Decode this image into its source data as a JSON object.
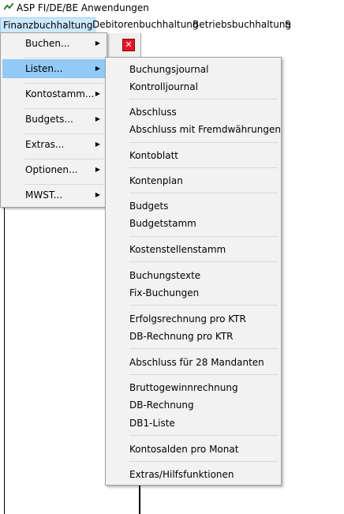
{
  "window": {
    "title": "ASP FI/DE/BE Anwendungen",
    "icon": "app-icon"
  },
  "menubar": {
    "items": [
      "Finanzbuchhaltung",
      "Debitorenbuchhaltung",
      "Betriebsbuchhaltung",
      "S"
    ]
  },
  "menu1": {
    "items": [
      "Buchen...",
      "Listen...",
      "Kontostamm...",
      "Budgets...",
      "Extras...",
      "Optionen...",
      "MWST..."
    ],
    "highlighted": "Listen..."
  },
  "menu2": {
    "groups": [
      [
        "Buchungsjournal",
        "Kontrolljournal"
      ],
      [
        "Abschluss",
        "Abschluss mit Fremdwährungen"
      ],
      [
        "Kontoblatt"
      ],
      [
        "Kontenplan"
      ],
      [
        "Budgets",
        "Budgetstamm"
      ],
      [
        "Kostenstellenstamm"
      ],
      [
        "Buchungstexte",
        "Fix-Buchungen"
      ],
      [
        "Erfolgsrechnung pro KTR",
        "DB-Rechnung pro KTR"
      ],
      [
        "Abschluss für 28 Mandanten"
      ],
      [
        "Bruttogewinnrechnung",
        "DB-Rechnung",
        "DB1-Liste"
      ],
      [
        "Kontosalden pro Monat"
      ],
      [
        "Extras/Hilfsfunktionen"
      ]
    ]
  },
  "colors": {
    "highlight": "#91c9f7",
    "menubar_active": "#cce8ff",
    "close": "#e81123"
  }
}
